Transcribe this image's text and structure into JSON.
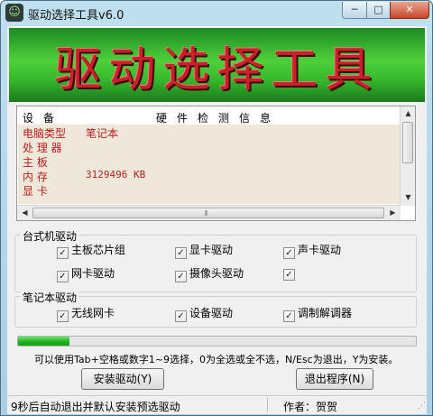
{
  "window": {
    "title": "驱动选择工具v6.0",
    "icon": "app-icon",
    "controls": {
      "minimize": "─",
      "maximize": "□",
      "close": "✕"
    }
  },
  "banner": {
    "text": "驱动选择工具"
  },
  "hardware_info": {
    "header_left": "设备",
    "header_right": "硬件检测信息",
    "rows": [
      {
        "key": "电脑类型",
        "value": "笔记本"
      },
      {
        "key": "处 理 器",
        "value": ""
      },
      {
        "key": "主    板",
        "value": ""
      },
      {
        "key": "内    存",
        "value": "3129496 KB"
      },
      {
        "key": "显    卡",
        "value": ""
      }
    ],
    "scroll_grip": "⦀"
  },
  "desktop_group": {
    "legend": "台式机驱动",
    "items": [
      {
        "label": "主板芯片组",
        "checked": true
      },
      {
        "label": "显卡驱动",
        "checked": true
      },
      {
        "label": "声卡驱动",
        "checked": true
      },
      {
        "label": "网卡驱动",
        "checked": true
      },
      {
        "label": "摄像头驱动",
        "checked": true
      },
      {
        "label": "",
        "checked": true
      }
    ]
  },
  "laptop_group": {
    "legend": "笔记本驱动",
    "items": [
      {
        "label": "无线网卡",
        "checked": true
      },
      {
        "label": "设备驱动",
        "checked": true
      },
      {
        "label": "调制解调器",
        "checked": true
      }
    ]
  },
  "progress": {
    "fraction": 0.13
  },
  "hint": "可以使用Tab+空格或数字1~9选择，0为全选或全不选，N/Esc为退出，Y为安装。",
  "buttons": {
    "install": "安装驱动(Y)",
    "exit": "退出程序(N)"
  },
  "status": {
    "left": "9秒后自动退出并默认安装预选驱动",
    "right": "作者：贺贺"
  },
  "colors": {
    "info_text": "#b41e1e",
    "banner_text": "#c9202a",
    "progress": "#1eb01e"
  }
}
